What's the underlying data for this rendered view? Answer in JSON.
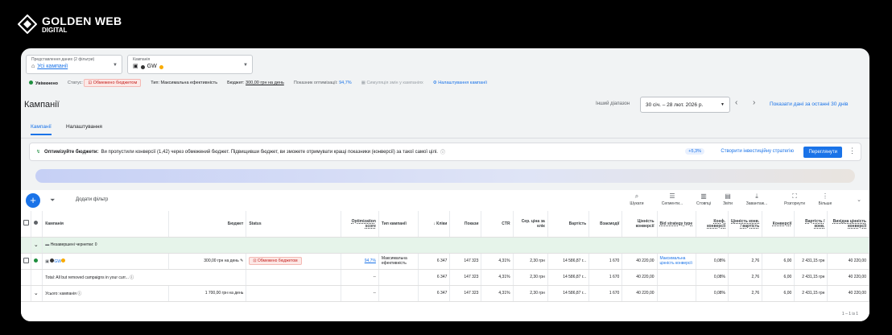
{
  "brand": {
    "name": "GOLDEN WEB",
    "sub": "DIGITAL"
  },
  "selectors": {
    "view": {
      "label": "Представлення даних (2 фільтри)",
      "value": "Усі кампанії"
    },
    "campaign": {
      "label": "Кампанія",
      "value": "GW"
    }
  },
  "status": {
    "state": "Увімкнено",
    "status_label": "Статус:",
    "status_value": "Обмежено бюджетом",
    "type": "Тип: Максимальна ефективність",
    "budget_label": "Бюджет:",
    "budget_value": "300,00 грн на день",
    "opt_label": "Показник оптимізації:",
    "opt_value": "94,7%",
    "simulate": "Симуляція змін у кампаніях",
    "settings": "Налаштування кампанії"
  },
  "header": {
    "title": "Кампанії",
    "range_label": "Інший діапазон",
    "range_value": "30 січ. – 28 лют. 2026 р.",
    "last30": "Показати дані за останні 30 днів"
  },
  "tabs": [
    "Кампанії",
    "Налаштування"
  ],
  "banner": {
    "title": "Оптимізуйте бюджети:",
    "text": "Ви пропустили конверсії (1,42) через обмежений бюджет. Підвищивши бюджет, ви зможете отримувати кращі показники (конверсії) за такої самої цілі.",
    "badge": "+5,3%",
    "link": "Створити інвестиційну стратегію",
    "button": "Переглянути"
  },
  "toolbar": {
    "add_filter": "Додати фільтр",
    "tools": [
      {
        "icon": "search-icon",
        "glyph": "⌕",
        "label": "Шукати"
      },
      {
        "icon": "segment-icon",
        "glyph": "☰",
        "label": "Сегменти..."
      },
      {
        "icon": "columns-icon",
        "glyph": "▥",
        "label": "Стовпці"
      },
      {
        "icon": "reports-icon",
        "glyph": "▤",
        "label": "Звіти"
      },
      {
        "icon": "download-icon",
        "glyph": "⤓",
        "label": "Завантаж..."
      },
      {
        "icon": "expand-icon",
        "glyph": "⛶",
        "label": "Розгорнути"
      },
      {
        "icon": "more-icon",
        "glyph": "⋮",
        "label": "Більше"
      }
    ]
  },
  "table": {
    "columns": [
      "Кампанія",
      "Бюджет",
      "Status",
      "Optimization score",
      "Тип кампанії",
      "↓ Кліки",
      "Покази",
      "CTR",
      "Сер. ціна за клік",
      "Вартість",
      "Взаємодії",
      "Цінність конверсії",
      "Bid strategy type",
      "Коеф. конверсії",
      "Цінність конв. / вартість",
      "Конверсії",
      "Вартість / конв.",
      "Вихідна цінність конверсії"
    ],
    "draft": "Незавершені чернетки: 0",
    "row": {
      "name": "GW",
      "budget": "300,00 грн на день",
      "status": "Обмежено бюджетом",
      "opt": "94,7%",
      "type": "Максимальна ефективність",
      "clicks": "6 347",
      "impr": "147 323",
      "ctr": "4,31%",
      "cpc": "2,30 грн",
      "cost": "14 586,87 г...",
      "inter": "1 670",
      "convval": "40 220,00",
      "bid": "Максимальна цінність конверсії",
      "convrate": "0,08%",
      "roas": "2,76",
      "conv": "6,00",
      "cpa": "2 431,15 грн",
      "origval": "40 220,00"
    },
    "total1": {
      "name": "Total: All but removed campaigns in your curr...",
      "opt": "--",
      "clicks": "6 347",
      "impr": "147 323",
      "ctr": "4,31%",
      "cpc": "2,30 грн",
      "cost": "14 586,87 г...",
      "inter": "1 670",
      "convval": "40 220,00",
      "convrate": "0,08%",
      "roas": "2,76",
      "conv": "6,00",
      "cpa": "2 431,15 грн",
      "origval": "40 220,00"
    },
    "total2": {
      "name": "Усього: кампанія",
      "budget": "1 700,00 грн на день",
      "opt": "--",
      "clicks": "6 347",
      "impr": "147 323",
      "ctr": "4,31%",
      "cpc": "2,30 грн",
      "cost": "14 586,87 г...",
      "inter": "1 670",
      "convval": "40 220,00",
      "convrate": "0,08%",
      "roas": "2,76",
      "conv": "6,00",
      "cpa": "2 431,15 грн",
      "origval": "40 220,00"
    },
    "pager": "1 – 1 із 1"
  },
  "colors": {
    "accent": "#1a73e8",
    "enabled": "#1e8e3e",
    "limited": "#c5221f"
  }
}
